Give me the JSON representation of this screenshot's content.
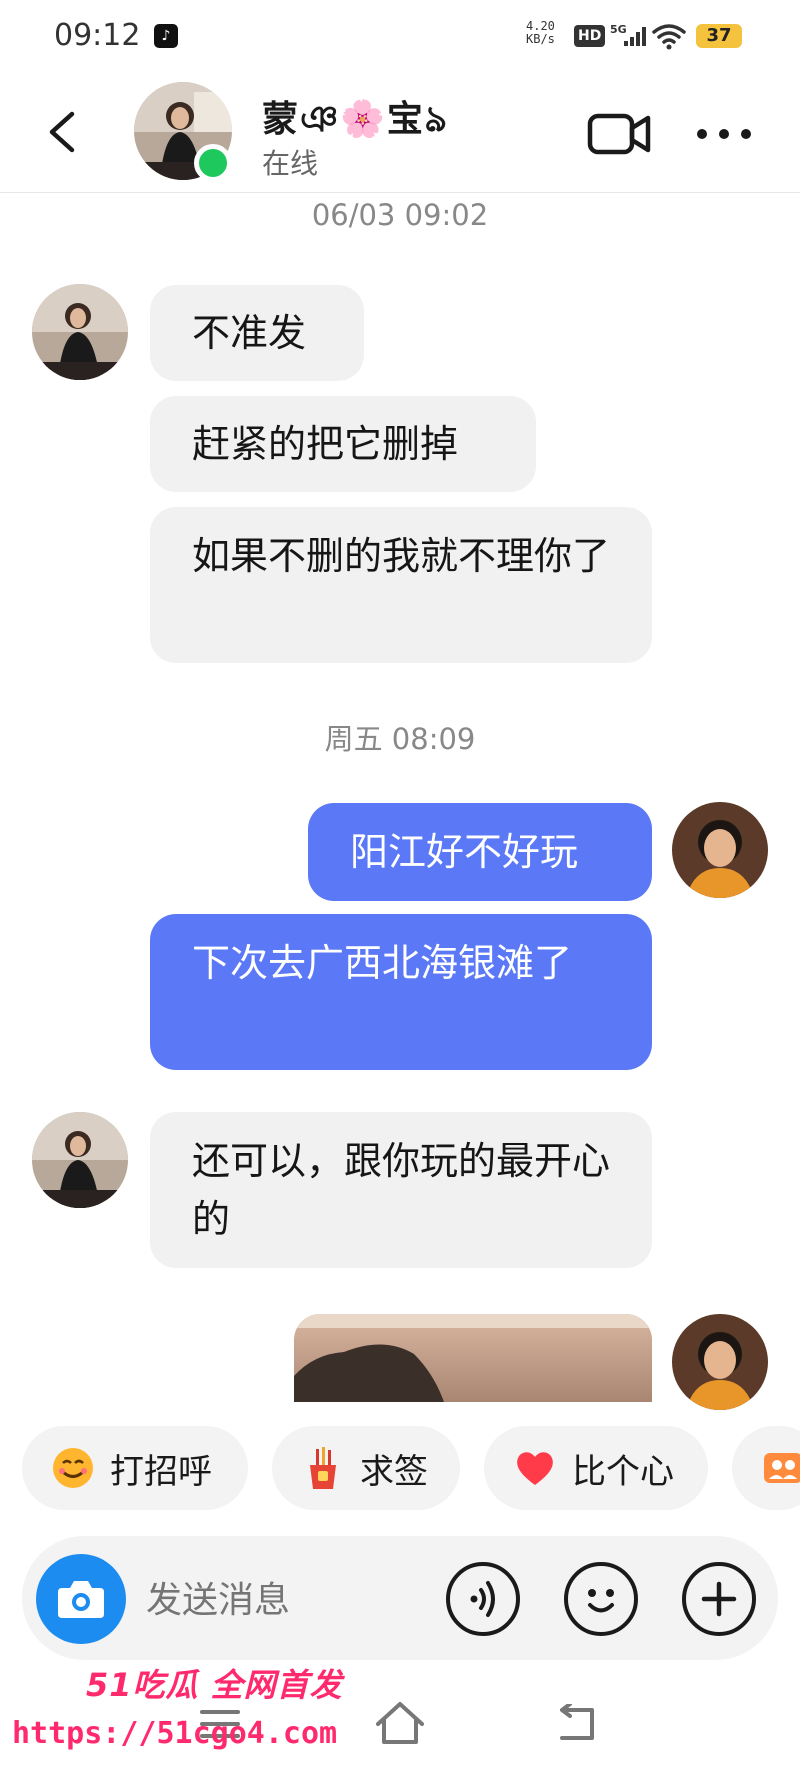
{
  "status_bar": {
    "time": "09:12",
    "net_speed_value": "4.20",
    "net_speed_unit": "KB/s",
    "hd": "HD",
    "network": "5G",
    "battery": "37"
  },
  "header": {
    "contact_name": "蒙ঞ🌸宝ঌ",
    "status": "在线"
  },
  "messages": [
    {
      "type": "timestamp",
      "text": "06/03 09:02"
    },
    {
      "type": "in",
      "text": "不准发"
    },
    {
      "type": "in",
      "text": "赶紧的把它删掉"
    },
    {
      "type": "in",
      "text": "如果不删的我就不理你了"
    },
    {
      "type": "timestamp",
      "text": "周五 08:09"
    },
    {
      "type": "out",
      "text": "阳江好不好玩"
    },
    {
      "type": "out",
      "text": "下次去广西北海银滩了"
    },
    {
      "type": "in",
      "text": "还可以，跟你玩的最开心的"
    },
    {
      "type": "out_image",
      "text": ""
    }
  ],
  "quick_replies": [
    {
      "label": "打招呼",
      "icon": "smile-face-icon"
    },
    {
      "label": "求签",
      "icon": "fortune-sticks-icon"
    },
    {
      "label": "比个心",
      "icon": "heart-icon"
    },
    {
      "label": "",
      "icon": "group-photo-icon"
    }
  ],
  "input": {
    "placeholder": "发送消息"
  },
  "watermark": {
    "brand": "51吃瓜 全网首发",
    "url": "https://51cgo4.com"
  },
  "colors": {
    "outgoing_bubble": "#5b79f6",
    "incoming_bubble": "#f1f1f1",
    "online": "#1ec85c",
    "camera": "#1d8cf0",
    "watermark": "#ff2a6d"
  }
}
